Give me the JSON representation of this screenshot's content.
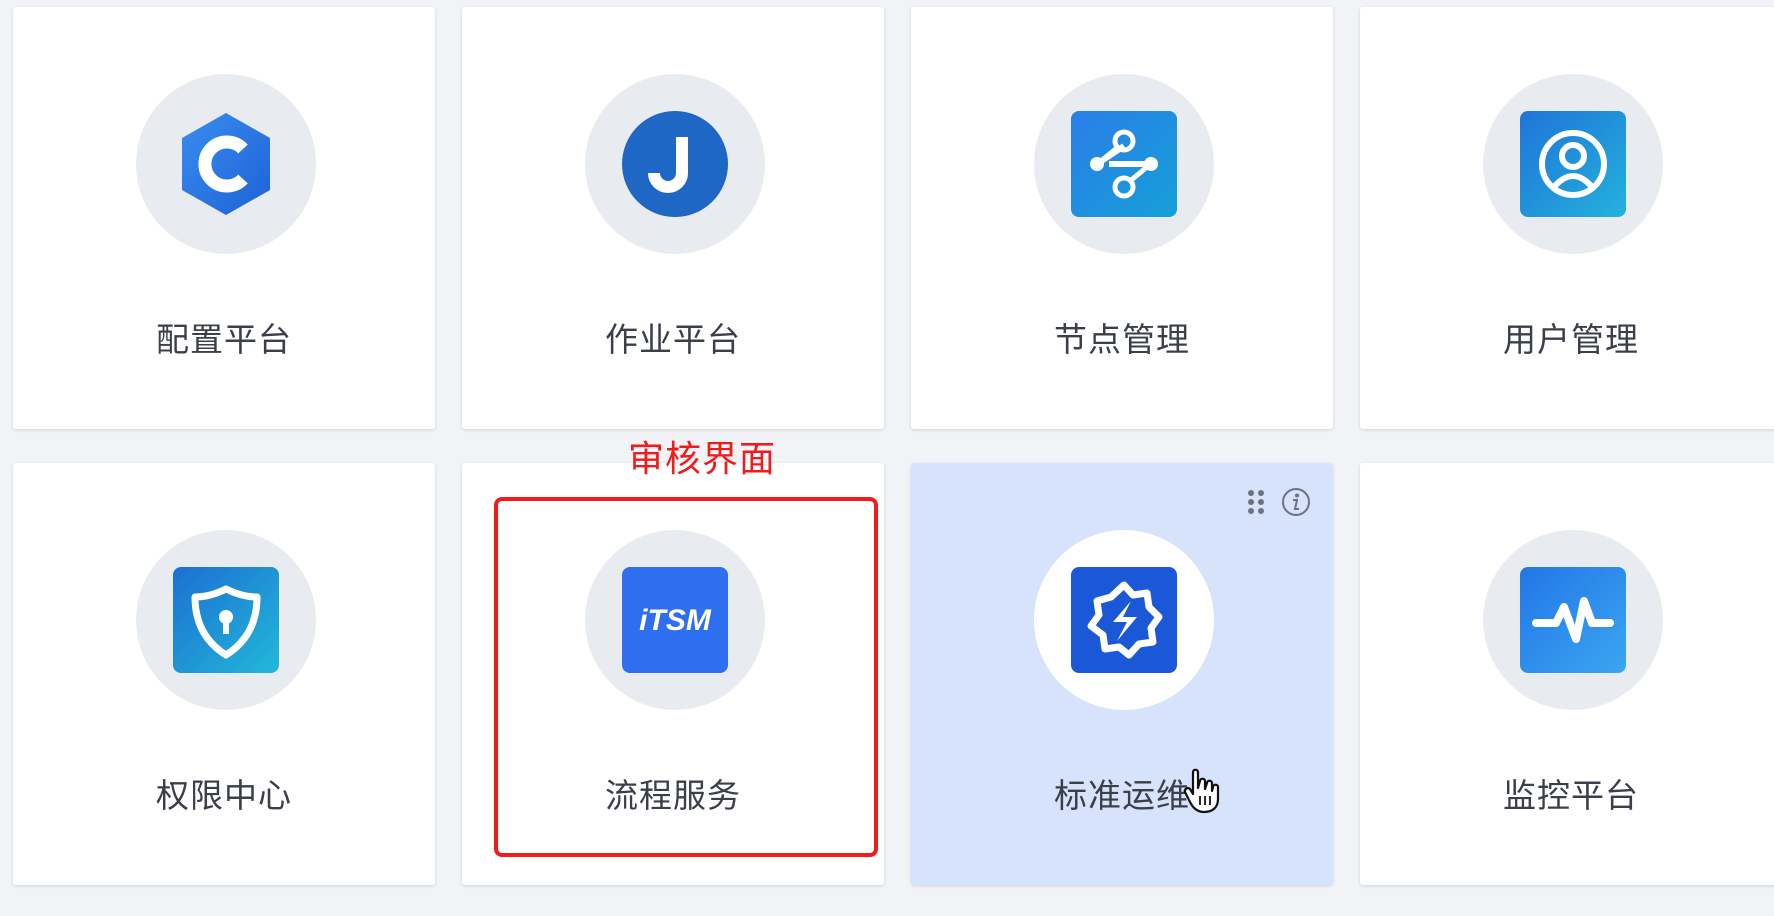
{
  "cards": [
    {
      "label": "配置平台",
      "icon": "cmdb-hexagon-c-icon",
      "color": "#2b7be6"
    },
    {
      "label": "作业平台",
      "icon": "job-j-icon",
      "color": "#1f67c4"
    },
    {
      "label": "节点管理",
      "icon": "node-manage-icon",
      "color": "#1a8be0"
    },
    {
      "label": "用户管理",
      "icon": "user-manage-icon",
      "color": "#1c92d8"
    },
    {
      "label": "权限中心",
      "icon": "permission-shield-icon",
      "color": "#1a9ad8"
    },
    {
      "label": "流程服务",
      "icon": "itsm-icon",
      "icon_text": "iTSM",
      "color": "#2e6ff0"
    },
    {
      "label": "标准运维",
      "icon": "sops-gear-icon",
      "color": "#1b58d8"
    },
    {
      "label": "监控平台",
      "icon": "monitor-pulse-icon",
      "color": "#2a88ea"
    }
  ],
  "annotation": {
    "text": "审核界面",
    "color": "#ee1c1c"
  },
  "hover_card_index": 6,
  "highlighted_card_index": 5
}
